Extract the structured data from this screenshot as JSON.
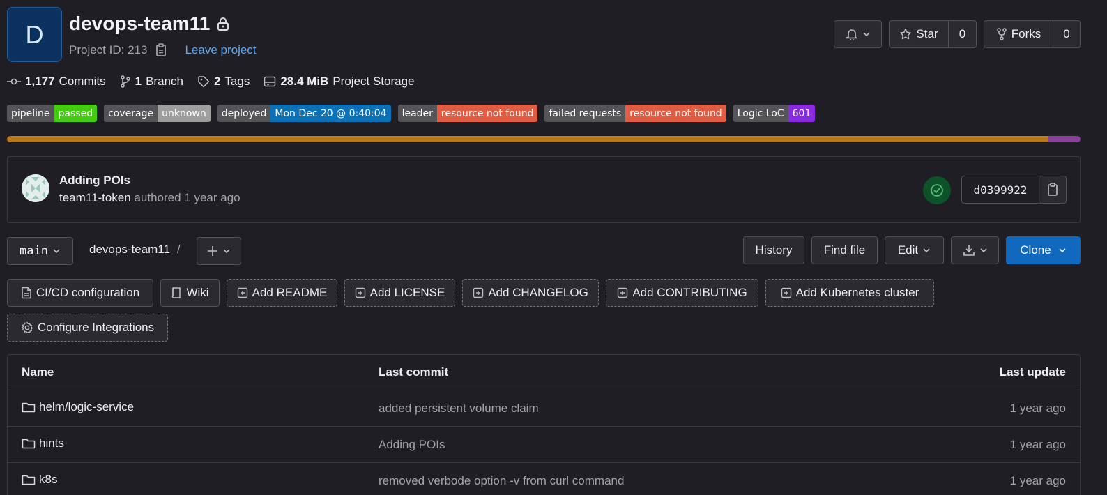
{
  "project": {
    "avatar_letter": "D",
    "name": "devops-team11",
    "id_label": "Project ID: 213",
    "leave_label": "Leave project"
  },
  "actions": {
    "star_label": "Star",
    "star_count": "0",
    "forks_label": "Forks",
    "forks_count": "0"
  },
  "stats": {
    "commits_count": "1,177",
    "commits_label": "Commits",
    "branch_count": "1",
    "branch_label": "Branch",
    "tags_count": "2",
    "tags_label": "Tags",
    "storage_value": "28.4 MiB",
    "storage_label": "Project Storage"
  },
  "badges": [
    {
      "label": "pipeline",
      "value": "passed",
      "color": "#44cc11"
    },
    {
      "label": "coverage",
      "value": "unknown",
      "color": "#9f9f9f"
    },
    {
      "label": "deployed",
      "value": "Mon Dec 20 @ 0:40:04",
      "color": "#0c72b8"
    },
    {
      "label": "leader",
      "value": "resource not found",
      "color": "#e05d44"
    },
    {
      "label": "failed requests",
      "value": "resource not found",
      "color": "#e05d44"
    },
    {
      "label": "Logic LoC",
      "value": "601",
      "color": "#8a2be2"
    }
  ],
  "languages": [
    {
      "share": 0.97,
      "color": "#b8791c"
    },
    {
      "share": 0.03,
      "color": "#8a3f9a"
    }
  ],
  "last_commit": {
    "title": "Adding POIs",
    "author": "team11-token",
    "authored_label": "authored",
    "time": "1 year ago",
    "sha": "d0399922"
  },
  "toolbar": {
    "branch": "main",
    "path": "devops-team11",
    "path_sep": "/",
    "history": "History",
    "find_file": "Find file",
    "edit": "Edit",
    "clone": "Clone"
  },
  "shortcuts": [
    {
      "label": "CI/CD configuration",
      "style": "solid",
      "icon": "file-icon"
    },
    {
      "label": "Wiki",
      "style": "solid",
      "icon": "book-icon"
    },
    {
      "label": "Add README",
      "style": "dashed",
      "icon": "plus-square-icon"
    },
    {
      "label": "Add LICENSE",
      "style": "dashed",
      "icon": "plus-square-icon"
    },
    {
      "label": "Add CHANGELOG",
      "style": "dashed",
      "icon": "plus-square-icon"
    },
    {
      "label": "Add CONTRIBUTING",
      "style": "dashed",
      "icon": "plus-square-icon"
    },
    {
      "label": "Add Kubernetes cluster",
      "style": "dashed",
      "icon": "plus-square-icon"
    },
    {
      "label": "Configure Integrations",
      "style": "dashed",
      "icon": "gear-icon"
    }
  ],
  "table": {
    "headers": {
      "name": "Name",
      "last_commit": "Last commit",
      "last_update": "Last update"
    },
    "rows": [
      {
        "name": "helm/logic-service",
        "commit": "added persistent volume claim",
        "updated": "1 year ago"
      },
      {
        "name": "hints",
        "commit": "Adding POIs",
        "updated": "1 year ago"
      },
      {
        "name": "k8s",
        "commit": "removed verbode option -v from curl command",
        "updated": "1 year ago"
      }
    ]
  }
}
